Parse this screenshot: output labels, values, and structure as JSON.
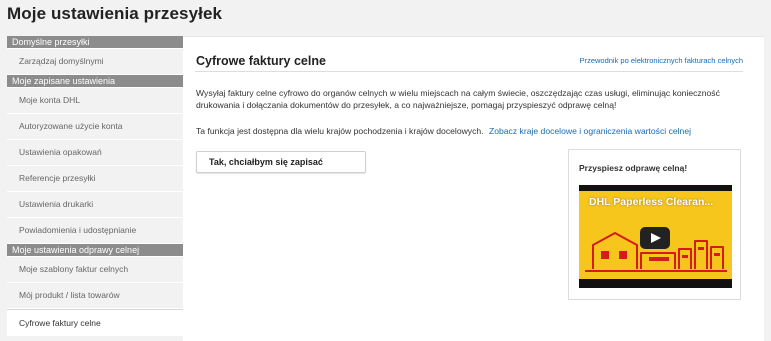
{
  "page": {
    "title": "Moje ustawienia przesyłek"
  },
  "sidebar": {
    "sections": [
      {
        "title": "Domyślne przesyłki",
        "items": [
          "Zarządzaj domyślnymi"
        ]
      },
      {
        "title": "Moje zapisane ustawienia",
        "items": [
          "Moje konta DHL",
          "Autoryzowane użycie konta",
          "Ustawienia opakowań",
          "Referencje przesyłki",
          "Ustawienia drukarki",
          "Powiadomienia i udostępnianie"
        ]
      },
      {
        "title": "Moje ustawienia odprawy celnej",
        "items": [
          "Moje szablony faktur celnych",
          "Mój produkt / lista towarów",
          "Cyfrowe faktury celne"
        ]
      }
    ],
    "active_item": "Cyfrowe faktury celne"
  },
  "main": {
    "title": "Cyfrowe faktury celne",
    "guide_link": "Przewodnik po elektronicznych fakturach celnych",
    "description": "Wysyłaj faktury celne cyfrowo do organów celnych w wielu miejscach na całym świecie, oszczędzając czas usługi, eliminując konieczność drukowania i dołączania dokumentów do przesyłek, a co najważniejsze, pomagaj przyspieszyć odprawę celną!",
    "availability_text": "Ta funkcja jest dostępna dla wielu krajów pochodzenia i krajów docelowych.",
    "countries_link": "Zobacz kraje docelowe i ograniczenia wartości celnej",
    "signup_button": "Tak, chciałbym się zapisać",
    "video": {
      "box_title": "Przyspiesz odprawę celną!",
      "caption": "DHL Paperless Clearan...",
      "frame_color": "#f6c61d",
      "graphic_color": "#d71a1a",
      "icon": "play-icon"
    }
  },
  "colors": {
    "accent_link": "#1a69b8",
    "section_header": "#8c8c8c",
    "background": "#f2f2f2"
  }
}
